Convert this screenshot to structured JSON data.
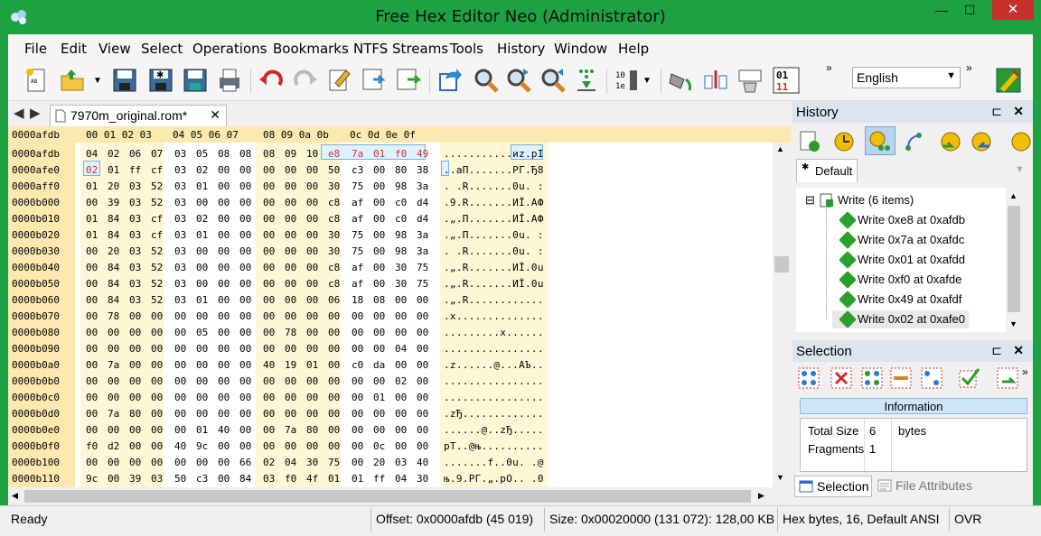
{
  "window": {
    "title": "Free Hex Editor Neo (Administrator)",
    "min_glyph": "—",
    "max_glyph": "☐",
    "close_glyph": "✕"
  },
  "menu": [
    "File",
    "Edit",
    "View",
    "Select",
    "Operations",
    "Bookmarks",
    "NTFS Streams",
    "Tools",
    "History",
    "Window",
    "Help"
  ],
  "menu_underline": [
    "F",
    "E",
    "V",
    "S",
    "O",
    "B",
    "",
    "T",
    "H",
    "W",
    "H"
  ],
  "toolbar": {
    "language": "English",
    "icons": [
      "new-file-icon",
      "open-file-icon",
      "open-dropdown-icon",
      "save-icon",
      "save-all-icon",
      "save-as-icon",
      "print-icon",
      "undo-icon",
      "redo-icon",
      "find-icon",
      "replace-icon",
      "paste-icon",
      "goto-icon",
      "search-icon",
      "search-next-icon",
      "search-prev-icon",
      "download-icon",
      "columns-icon",
      "fill-icon",
      "insert-icon",
      "delete-icon",
      "ascii-table-icon",
      "binary-view-icon",
      "language-icon"
    ],
    "binary_view_label": "01\n11"
  },
  "document": {
    "nav_back": "◀",
    "nav_forward": "▶",
    "tab_label": "7970m_original.rom*",
    "tab_close": "✕",
    "header_offset": "0000afdb",
    "header_columns": [
      "00 01 02 03",
      "04 05 06 07",
      "08 09 0a 0b",
      "0c 0d 0e 0f"
    ],
    "rows": [
      {
        "offset": "0000afdb",
        "hex": "04 02 06 07  03 05 08 08  08 09 10 e8  7a 01 f0 49",
        "ascii": "...........иz.рI"
      },
      {
        "offset": "0000afe0",
        "hex": "02 01 ff cf  03 02 00 00  00 00 00 50  c3 00 80 38",
        "ascii": "..аП.......РГ.Ђ8"
      },
      {
        "offset": "0000aff0",
        "hex": "01 20 03 52  03 01 00 00  00 00 00 30  75 00 98 3a",
        "ascii": ". .R.......0u. :"
      },
      {
        "offset": "0000b000",
        "hex": "00 39 03 52  03 00 00 00  00 00 00 c8  af 00 c0 d4",
        "ascii": ".9.R.......ИЇ.АФ"
      },
      {
        "offset": "0000b010",
        "hex": "01 84 03 cf  03 02 00 00  00 00 00 c8  af 00 c0 d4",
        "ascii": ".„.П.......ИЇ.АФ"
      },
      {
        "offset": "0000b020",
        "hex": "01 84 03 cf  03 01 00 00  00 00 00 30  75 00 98 3a",
        "ascii": ".„.П.......0u. :"
      },
      {
        "offset": "0000b030",
        "hex": "00 20 03 52  03 00 00 00  00 00 00 30  75 00 98 3a",
        "ascii": ". .R.......0u. :"
      },
      {
        "offset": "0000b040",
        "hex": "00 84 03 52  03 00 00 00  00 00 00 c8  af 00 30 75",
        "ascii": ".„.R.......ИЇ.0u"
      },
      {
        "offset": "0000b050",
        "hex": "00 84 03 52  03 00 00 00  00 00 00 c8  af 00 30 75",
        "ascii": ".„.R.......ИЇ.0u"
      },
      {
        "offset": "0000b060",
        "hex": "00 84 03 52  03 01 00 00  00 00 00 06  18 08 00 00",
        "ascii": ".„.R............"
      },
      {
        "offset": "0000b070",
        "hex": "00 78 00 00  00 00 00 00  00 00 00 00  00 00 00 00",
        "ascii": ".x.............."
      },
      {
        "offset": "0000b080",
        "hex": "00 00 00 00  00 05 00 00  00 78 00 00  00 00 00 00",
        "ascii": ".........x......"
      },
      {
        "offset": "0000b090",
        "hex": "00 00 00 00  00 00 00 00  00 00 00 00  00 00 04 00",
        "ascii": "................"
      },
      {
        "offset": "0000b0a0",
        "hex": "00 7a 00 00  00 00 00 00  40 19 01 00  c0 da 00 00",
        "ascii": ".z......@...АЪ.."
      },
      {
        "offset": "0000b0b0",
        "hex": "00 00 00 00  00 00 00 00  00 00 00 00  00 00 02 00",
        "ascii": "................"
      },
      {
        "offset": "0000b0c0",
        "hex": "00 00 00 00  00 00 00 00  00 00 00 00  00 01 00 00",
        "ascii": "................"
      },
      {
        "offset": "0000b0d0",
        "hex": "00 7a 80 00  00 00 00 00  00 00 00 00  00 00 00 00",
        "ascii": ".zЂ............."
      },
      {
        "offset": "0000b0e0",
        "hex": "00 00 00 00  00 01 40 00  00 7a 80 00  00 00 00 00",
        "ascii": "......@..zЂ....."
      },
      {
        "offset": "0000b0f0",
        "hex": "f0 d2 00 00  40 9c 00 00  00 00 00 00  00 0c 00 00",
        "ascii": "рТ..@њ.........."
      },
      {
        "offset": "0000b100",
        "hex": "00 00 00 00  00 00 00 66  02 04 30 75  00 20 03 40",
        "ascii": ".......f..0u. .@"
      },
      {
        "offset": "0000b110",
        "hex": "9c 00 39 03  50 c3 00 84  03 f0 4f 01  01 ff 04 30",
        "ascii": "њ.9.РГ.„.рO.. .0"
      }
    ]
  },
  "history_panel": {
    "title": "History",
    "pin_glyph": "⊏",
    "close_glyph": "✕",
    "tab": "Default",
    "tab_marker": "✱",
    "expander": "⊟",
    "group": "Write (6 items)",
    "items": [
      "Write 0xe8 at 0xafdb",
      "Write 0x7a at 0xafdc",
      "Write 0x01 at 0xafdd",
      "Write 0xf0 at 0xafde",
      "Write 0x49 at 0xafdf",
      "Write 0x02 at 0xafe0"
    ]
  },
  "selection_panel": {
    "title": "Selection",
    "pin_glyph": "⊏",
    "close_glyph": "✕",
    "info_header": "Information",
    "rows": [
      {
        "label": "Total Size",
        "value": "6",
        "unit": "bytes"
      },
      {
        "label": "Fragments",
        "value": "1",
        "unit": ""
      }
    ],
    "tabs": [
      "Selection",
      "File Attributes"
    ]
  },
  "statusbar": {
    "state": "Ready",
    "offset": "Offset: 0x0000afdb (45 019)",
    "size": "Size: 0x00020000 (131 072): 128,00 KB",
    "mode": "Hex bytes, 16, Default ANSI",
    "ovr": "OVR"
  },
  "colors": {
    "titlebar": "#1da141",
    "offset_col": "#fde8b0",
    "ascii_bg": "#fdf7d6",
    "modified": "#d03030",
    "panel_header": "#dbe4ef"
  }
}
